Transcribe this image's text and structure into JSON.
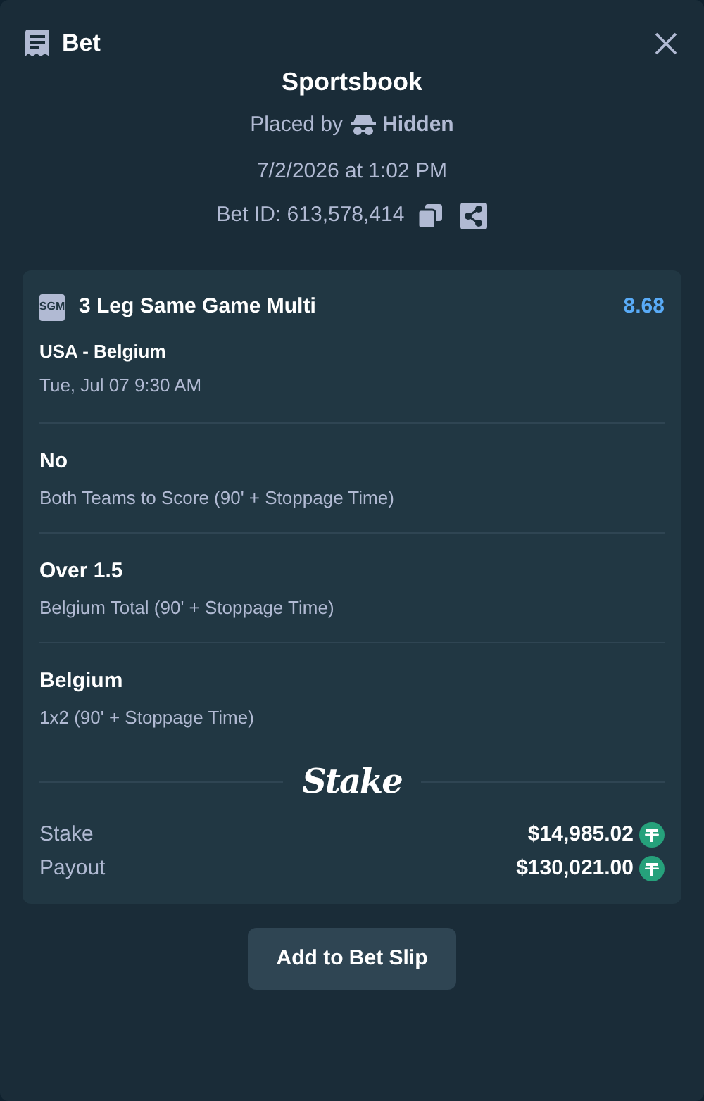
{
  "header": {
    "title": "Bet"
  },
  "summary": {
    "title": "Sportsbook",
    "placed_by_label": "Placed by",
    "user": "Hidden",
    "date": "7/2/2026 at 1:02 PM",
    "bet_id": "Bet ID: 613,578,414"
  },
  "bet": {
    "badge": "SGM",
    "title": "3 Leg Same Game Multi",
    "odds": "8.68",
    "event": "USA - Belgium",
    "event_time": "Tue, Jul 07 9:30 AM",
    "legs": [
      {
        "selection": "No",
        "market": "Both Teams to Score (90' + Stoppage Time)"
      },
      {
        "selection": "Over 1.5",
        "market": "Belgium Total (90' + Stoppage Time)"
      },
      {
        "selection": "Belgium",
        "market": "1x2 (90' + Stoppage Time)"
      }
    ],
    "brand": "Stake",
    "totals": [
      {
        "label": "Stake",
        "amount": "$14,985.02"
      },
      {
        "label": "Payout",
        "amount": "$130,021.00"
      }
    ]
  },
  "action_button": "Add to Bet Slip"
}
